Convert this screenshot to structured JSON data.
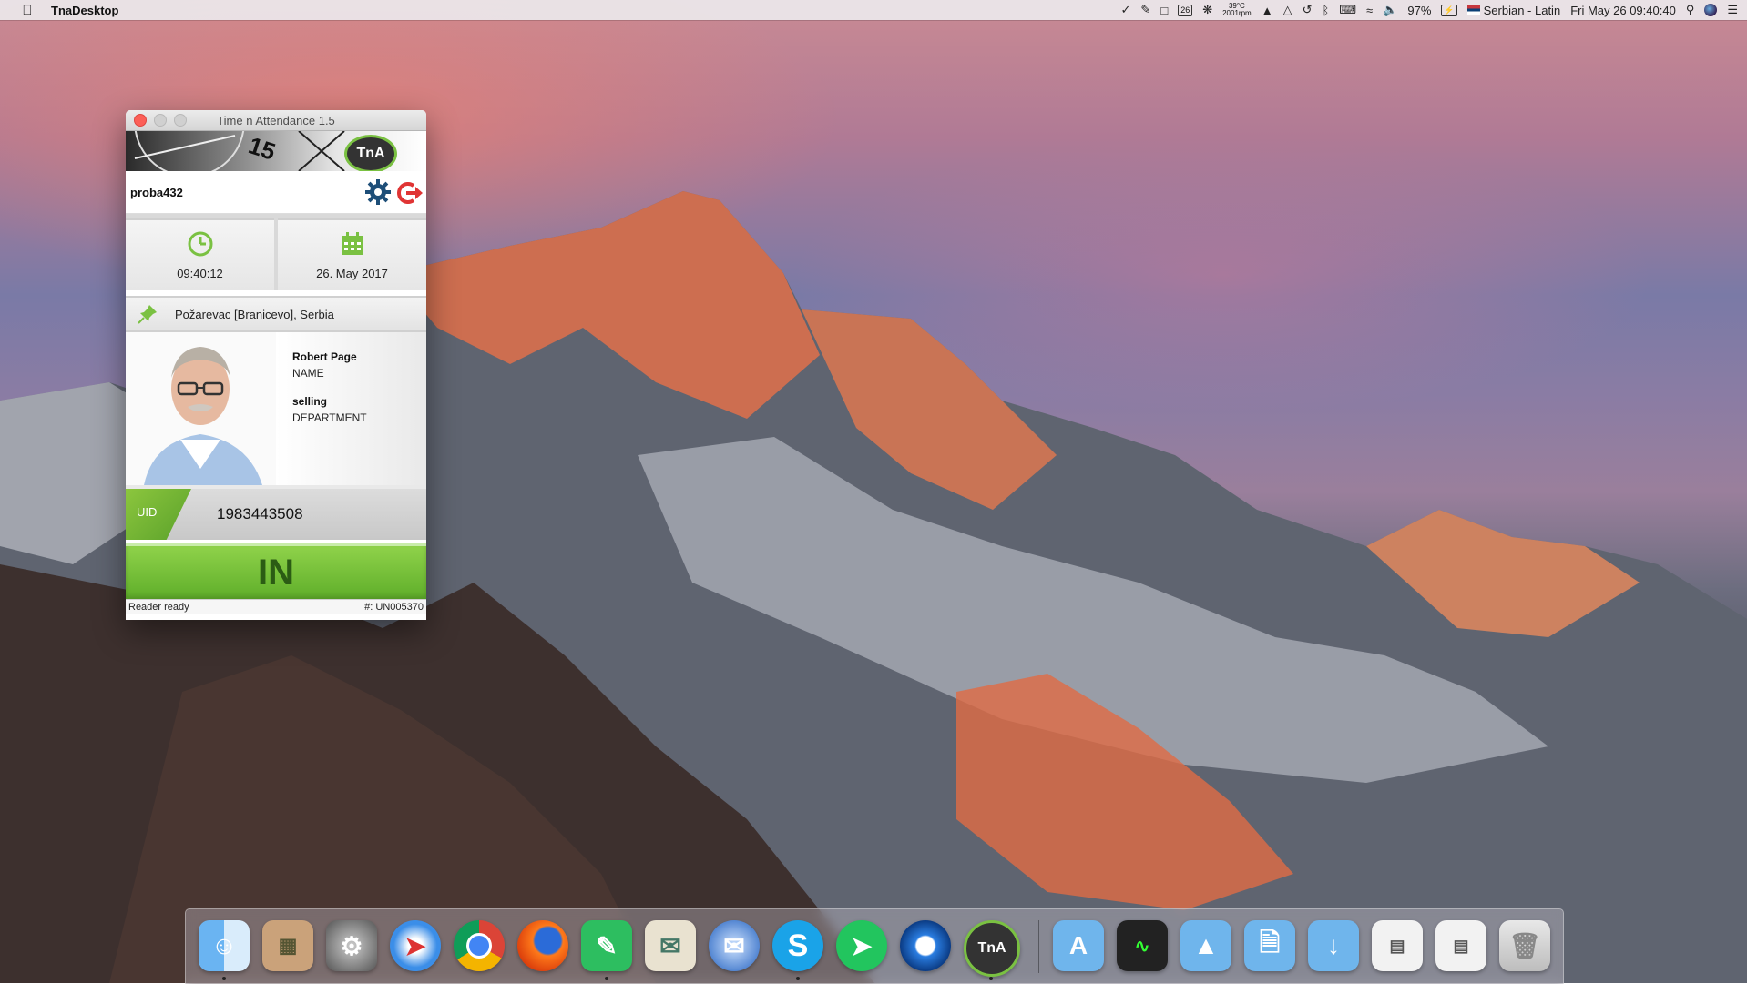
{
  "menubar": {
    "app_name": "TnaDesktop",
    "temp_top": "39°C",
    "temp_bottom": "2001rpm",
    "calendar_day": "26",
    "battery": "97%",
    "input_source": "Serbian - Latin",
    "datetime": "Fri May 26  09:40:40"
  },
  "window": {
    "title": "Time n Attendance 1.5",
    "banner_number": "15",
    "logo_text": "TnA",
    "username": "proba432",
    "time": "09:40:12",
    "date": "26. May 2017",
    "location": "Požarevac [Branicevo], Serbia",
    "person": {
      "name_value": "Robert Page",
      "name_label": "NAME",
      "department_value": "selling",
      "department_label": "DEPARTMENT"
    },
    "uid_label": "UID",
    "uid_value": "1983443508",
    "in_button": "IN",
    "status_left": "Reader ready",
    "status_right": "#: UN005370"
  },
  "colors": {
    "accent_green": "#7ac142",
    "gear_blue": "#1d4e78",
    "logout_red": "#e03434"
  },
  "dock": {
    "apps": [
      "Finder",
      "Calculator",
      "System Preferences",
      "Safari",
      "Chrome",
      "Firefox",
      "Evernote",
      "Mail",
      "Thunderbird",
      "Skype",
      "Airmail",
      "QuickTime",
      "TnA"
    ],
    "folders": [
      "Applications",
      "Activity Monitor",
      "Google Drive",
      "Documents",
      "Downloads",
      "Screenshot 1",
      "Screenshot 2",
      "Trash"
    ]
  }
}
